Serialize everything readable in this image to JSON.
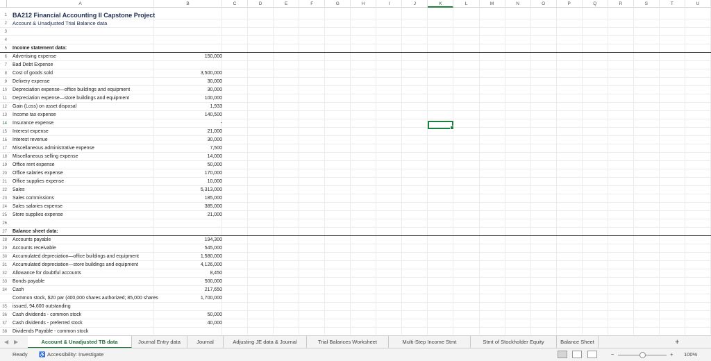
{
  "columns": [
    "A",
    "B",
    "C",
    "D",
    "E",
    "F",
    "G",
    "H",
    "I",
    "J",
    "K",
    "L",
    "M",
    "N",
    "O",
    "P",
    "Q",
    "R",
    "S",
    "T",
    "U"
  ],
  "selected_column": "K",
  "selected_row": "14",
  "rows": [
    {
      "n": "1",
      "a": "BA212 Financial Accounting II Capstone Project",
      "b": "",
      "style": "title"
    },
    {
      "n": "2",
      "a": "Account & Unadjusted Trial Balance data",
      "b": "",
      "style": "subtitle"
    },
    {
      "n": "3",
      "a": "",
      "b": ""
    },
    {
      "n": "4",
      "a": "",
      "b": ""
    },
    {
      "n": "5",
      "a": "Income statement data:",
      "b": "",
      "style": "bold-under"
    },
    {
      "n": "6",
      "a": "Advertising expense",
      "b": "150,000"
    },
    {
      "n": "7",
      "a": "Bad Debt Expense",
      "b": ""
    },
    {
      "n": "8",
      "a": "Cost of goods sold",
      "b": "3,500,000"
    },
    {
      "n": "9",
      "a": "Delivery expense",
      "b": "30,000"
    },
    {
      "n": "10",
      "a": "Depreciation expense—office buildings and equipment",
      "b": "30,000"
    },
    {
      "n": "11",
      "a": "Depreciation expense—store buildings and equipment",
      "b": "100,000"
    },
    {
      "n": "12",
      "a": "Gain (Loss) on asset disposal",
      "b": "1,933"
    },
    {
      "n": "13",
      "a": "Income tax expense",
      "b": "140,500"
    },
    {
      "n": "14",
      "a": "Insurance expense",
      "b": "-"
    },
    {
      "n": "15",
      "a": "Interest expense",
      "b": "21,000"
    },
    {
      "n": "16",
      "a": "Interest revenue",
      "b": "30,000"
    },
    {
      "n": "17",
      "a": "Miscellaneous administrative expense",
      "b": "7,500"
    },
    {
      "n": "18",
      "a": "Miscellaneous selling expense",
      "b": "14,000"
    },
    {
      "n": "19",
      "a": "Office rent expense",
      "b": "50,000"
    },
    {
      "n": "20",
      "a": "Office salaries expense",
      "b": "170,000"
    },
    {
      "n": "21",
      "a": "Office supplies expense",
      "b": "10,000"
    },
    {
      "n": "22",
      "a": "Sales",
      "b": "5,313,000"
    },
    {
      "n": "23",
      "a": "Sales commissions",
      "b": "185,000"
    },
    {
      "n": "24",
      "a": "Sales salaries expense",
      "b": "385,000"
    },
    {
      "n": "25",
      "a": "Store supplies expense",
      "b": "21,000"
    },
    {
      "n": "26",
      "a": "",
      "b": ""
    },
    {
      "n": "27",
      "a": "Balance sheet data:",
      "b": "",
      "style": "bold-under"
    },
    {
      "n": "28",
      "a": "Accounts payable",
      "b": "194,300"
    },
    {
      "n": "29",
      "a": "Accounts receivable",
      "b": "545,000"
    },
    {
      "n": "30",
      "a": "Accumulated depreciation—office buildings and equipment",
      "b": "1,580,000"
    },
    {
      "n": "31",
      "a": "Accumulated depreciation—store buildings and equipment",
      "b": "4,126,000"
    },
    {
      "n": "32",
      "a": "Allowance for doubtful accounts",
      "b": "8,450"
    },
    {
      "n": "33",
      "a": "Bonds payable",
      "b": "500,000"
    },
    {
      "n": "34",
      "a": "Cash",
      "b": "217,650"
    },
    {
      "n": "",
      "a": "Common stock, $20 par (400,000 shares authorized; 85,000 shares",
      "b": "1,700,000"
    },
    {
      "n": "35",
      "a": "issued, 94,600 outstanding",
      "b": ""
    },
    {
      "n": "36",
      "a": "   Cash dividends - common stock",
      "b": "50,000"
    },
    {
      "n": "37",
      "a": "   Cash dividends - preferred stock",
      "b": "40,000"
    },
    {
      "n": "38",
      "a": "Dividends Payable - common stock",
      "b": ""
    }
  ],
  "sheet_tabs": [
    "Account & Unadjusted TB data",
    "Journal Entry data",
    "Journal",
    "Adjusting JE data & Journal",
    "Trial Balances Worksheet",
    "Multi-Step Income Stmt",
    "Stmt of Stockholder Equity",
    "Balance Sheet"
  ],
  "active_tab": "Account & Unadjusted TB data",
  "add_sheet_label": "+",
  "status": {
    "ready": "Ready",
    "accessibility": "Accessibility: Investigate",
    "zoom": "100%",
    "zoom_minus": "−",
    "zoom_plus": "+"
  },
  "colors": {
    "accent": "#1e7e3e",
    "title": "#1f2d50"
  }
}
